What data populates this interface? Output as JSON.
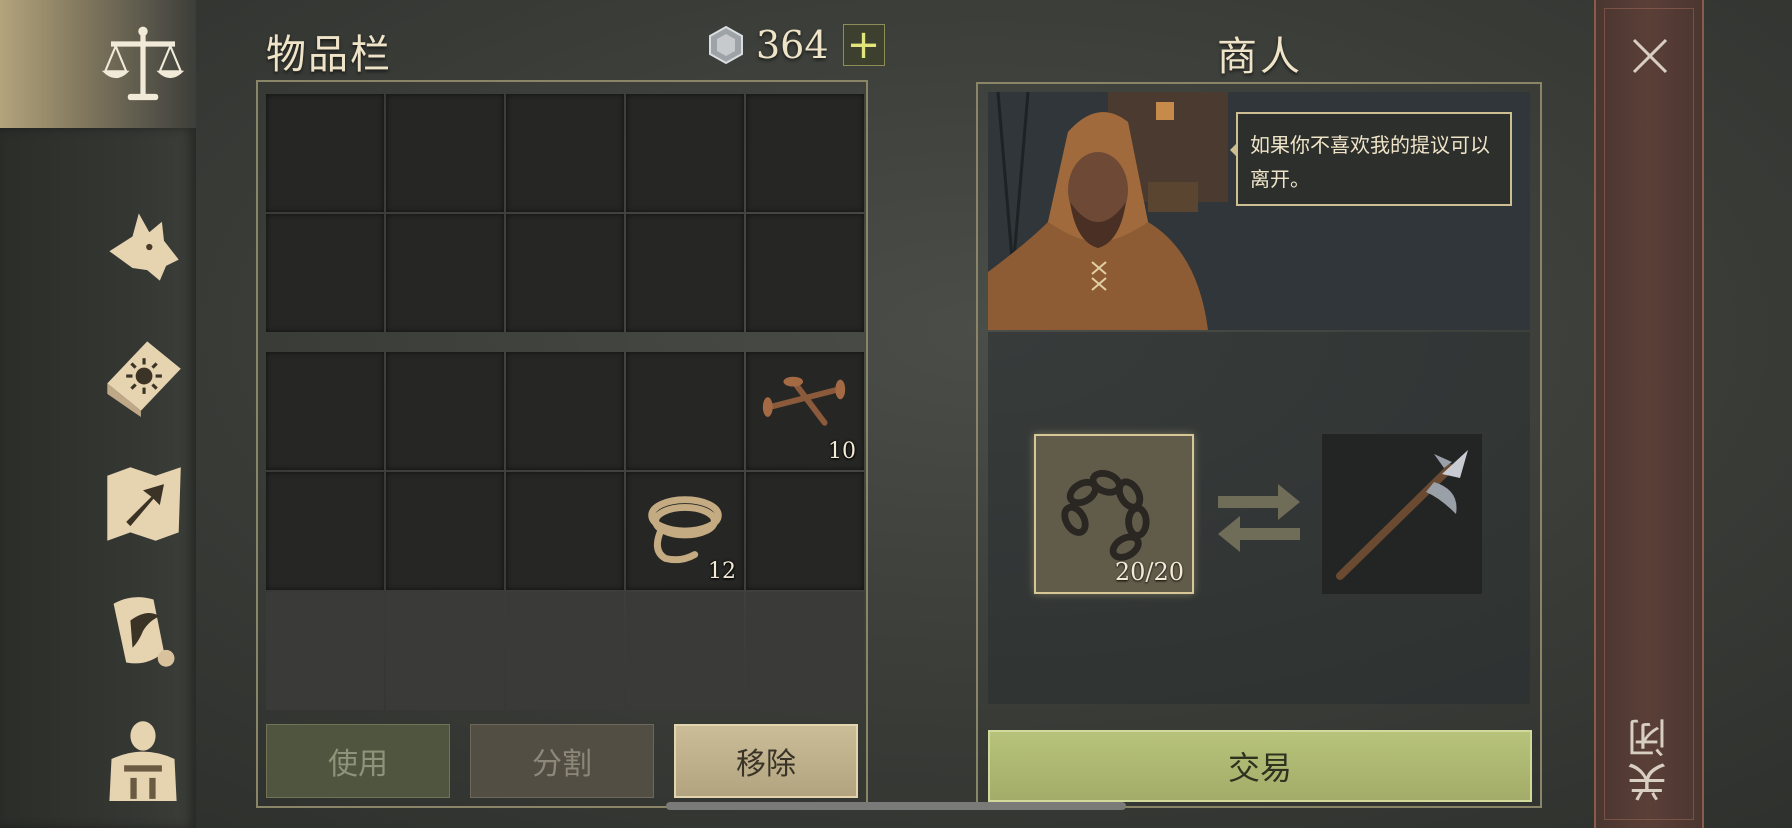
{
  "nav": {
    "items": [
      {
        "icon": "scales-icon",
        "active": true
      },
      {
        "icon": "wolf-head-icon",
        "active": false
      },
      {
        "icon": "sun-book-icon",
        "active": false
      },
      {
        "icon": "map-arrow-icon",
        "active": false
      },
      {
        "icon": "scroll-quill-icon",
        "active": false
      },
      {
        "icon": "character-gear-icon",
        "active": false
      }
    ]
  },
  "inventory": {
    "title": "物品栏",
    "currency_value": "364",
    "currency_icon": "silver-coin-icon",
    "add_label": "+",
    "items": [
      {
        "name": "nails",
        "icon": "nails-icon",
        "count": "10"
      },
      {
        "name": "rope",
        "icon": "rope-icon",
        "count": "12"
      }
    ],
    "buttons": {
      "use": "使用",
      "split": "分割",
      "remove": "移除"
    }
  },
  "merchant": {
    "title": "商人",
    "dialogue": "如果你不喜欢我的提议可以离开。",
    "give_item": {
      "icon": "chain-icon",
      "count": "20/20"
    },
    "get_item": {
      "icon": "halberd-icon"
    },
    "trade_label": "交易"
  },
  "close": {
    "label": "关闭"
  },
  "colors": {
    "trade_button": "#b7c27a",
    "remove_button": "#cbbd98",
    "close_bar": "#5a3f37"
  }
}
